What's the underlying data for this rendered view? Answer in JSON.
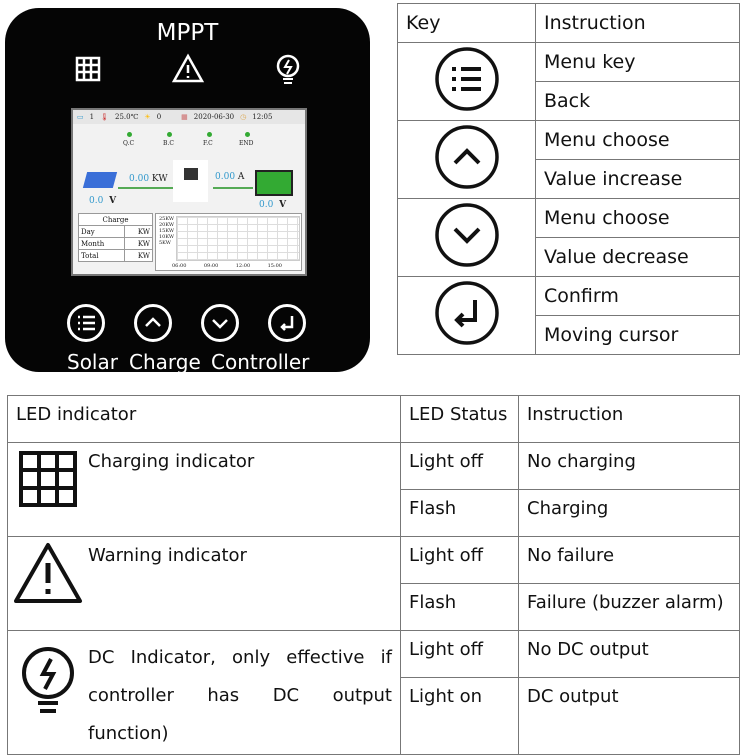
{
  "device": {
    "title": "MPPT",
    "keys": [
      "Solar",
      "Charge",
      "Controller"
    ],
    "lcd": {
      "battery_no": "1",
      "temp": "25.0℃",
      "sun": "0",
      "date": "2020-06-30",
      "time": "12:05",
      "stages": [
        "Q.C",
        "B.C",
        "F.C",
        "END"
      ],
      "pv_power": "0.00",
      "pv_power_unit": "KW",
      "current": "0.00",
      "current_unit": "A",
      "pv_voltage": "0.0",
      "batt_voltage": "0.0",
      "volt_unit": "V",
      "charge_header": "Charge",
      "rows": [
        {
          "label": "Day",
          "unit": "KW"
        },
        {
          "label": "Month",
          "unit": "KW"
        },
        {
          "label": "Total",
          "unit": "KW"
        }
      ],
      "y_ticks": [
        "25KW",
        "20KW",
        "15KW",
        "10KW",
        "5KW"
      ],
      "x_ticks": [
        "06:00",
        "09:00",
        "12:00",
        "15:00"
      ]
    }
  },
  "key_table": {
    "headers": [
      "Key",
      "Instruction"
    ],
    "rows": [
      {
        "icon": "menu-icon",
        "lines": [
          "Menu key",
          "Back"
        ]
      },
      {
        "icon": "chevron-up-icon",
        "lines": [
          "Menu choose",
          "Value increase"
        ]
      },
      {
        "icon": "chevron-down-icon",
        "lines": [
          "Menu choose",
          "Value decrease"
        ]
      },
      {
        "icon": "enter-icon",
        "lines": [
          "Confirm",
          "Moving cursor"
        ]
      }
    ]
  },
  "led_table": {
    "headers": [
      "LED indicator",
      "LED Status",
      "Instruction"
    ],
    "rows": [
      {
        "icon": "grid-icon",
        "name": "Charging indicator",
        "states": [
          [
            "Light off",
            "No charging"
          ],
          [
            "Flash",
            "Charging"
          ]
        ]
      },
      {
        "icon": "warning-icon",
        "name": "Warning indicator",
        "states": [
          [
            "Light off",
            "No failure"
          ],
          [
            "Flash",
            "Failure (buzzer alarm)"
          ]
        ]
      },
      {
        "icon": "bulb-icon",
        "name": "DC  Indicator, only effective if controller has DC output function)",
        "states": [
          [
            "Light off",
            "No DC output"
          ],
          [
            "Light on",
            "DC output"
          ]
        ]
      }
    ]
  }
}
